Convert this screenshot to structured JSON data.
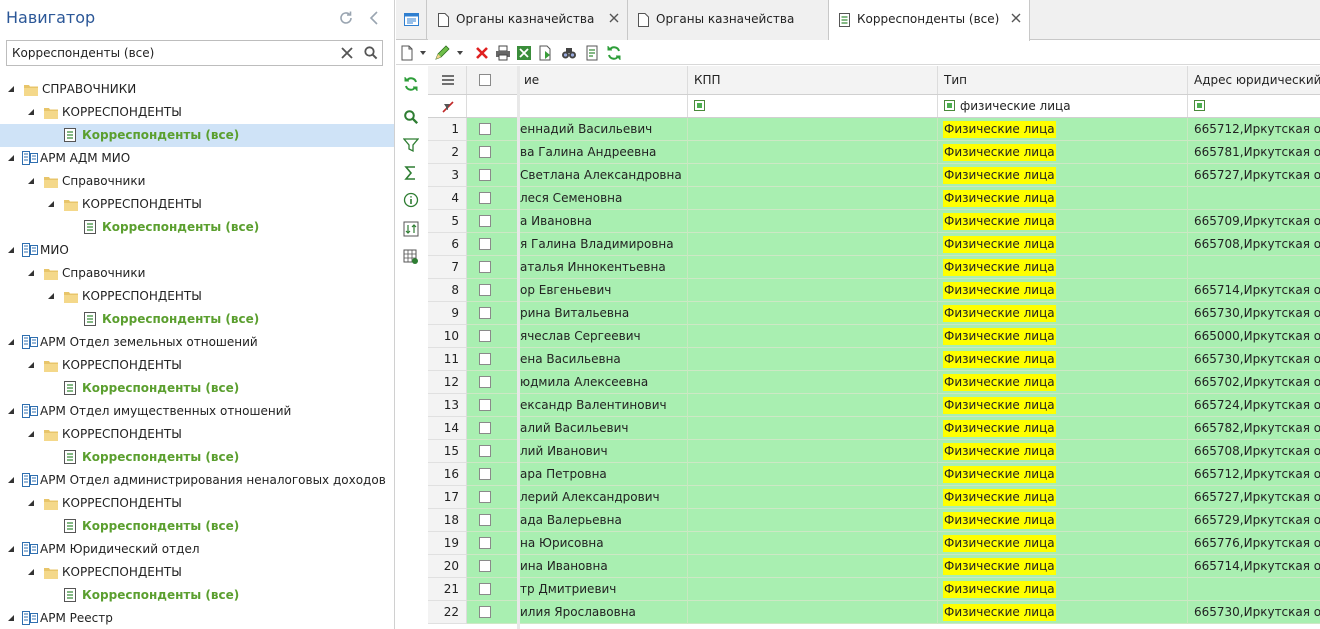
{
  "navigator": {
    "title": "Навигатор",
    "search_value": "Корреспонденты (все)",
    "tree": [
      {
        "level": 0,
        "kind": "folder",
        "label": "СПРАВОЧНИКИ"
      },
      {
        "level": 1,
        "kind": "folder",
        "label": "КОРРЕСПОНДЕНТЫ"
      },
      {
        "level": 2,
        "kind": "doc",
        "label": "Корреспонденты (все)",
        "selected": true
      },
      {
        "level": 0,
        "kind": "arm",
        "label": "АРМ АДМ МИО"
      },
      {
        "level": 1,
        "kind": "folder",
        "label": "Справочники"
      },
      {
        "level": 2,
        "kind": "folder",
        "label": "КОРРЕСПОНДЕНТЫ"
      },
      {
        "level": 3,
        "kind": "doc",
        "label": "Корреспонденты (все)"
      },
      {
        "level": 0,
        "kind": "arm",
        "label": "МИО"
      },
      {
        "level": 1,
        "kind": "folder",
        "label": "Справочники"
      },
      {
        "level": 2,
        "kind": "folder",
        "label": "КОРРЕСПОНДЕНТЫ"
      },
      {
        "level": 3,
        "kind": "doc",
        "label": "Корреспонденты (все)"
      },
      {
        "level": 0,
        "kind": "arm",
        "label": "АРМ Отдел земельных отношений"
      },
      {
        "level": 1,
        "kind": "folder",
        "label": "КОРРЕСПОНДЕНТЫ"
      },
      {
        "level": 2,
        "kind": "doc",
        "label": "Корреспонденты (все)"
      },
      {
        "level": 0,
        "kind": "arm",
        "label": "АРМ Отдел имущественных отношений"
      },
      {
        "level": 1,
        "kind": "folder",
        "label": "КОРРЕСПОНДЕНТЫ"
      },
      {
        "level": 2,
        "kind": "doc",
        "label": "Корреспонденты (все)"
      },
      {
        "level": 0,
        "kind": "arm",
        "label": "АРМ Отдел администрирования неналоговых доходов"
      },
      {
        "level": 1,
        "kind": "folder",
        "label": "КОРРЕСПОНДЕНТЫ"
      },
      {
        "level": 2,
        "kind": "doc",
        "label": "Корреспонденты (все)"
      },
      {
        "level": 0,
        "kind": "arm",
        "label": "АРМ Юридический отдел"
      },
      {
        "level": 1,
        "kind": "folder",
        "label": "КОРРЕСПОНДЕНТЫ"
      },
      {
        "level": 2,
        "kind": "doc",
        "label": "Корреспонденты (все)"
      },
      {
        "level": 0,
        "kind": "arm",
        "label": "АРМ Реестр"
      }
    ]
  },
  "tabs": [
    {
      "label": "Органы казначейства",
      "active": false,
      "closable": true
    },
    {
      "label": "Органы казначейства",
      "active": false,
      "closable": false
    },
    {
      "label": "Корреспонденты (все)",
      "active": true,
      "closable": true
    }
  ],
  "grid": {
    "columns": {
      "name": "ие",
      "kpp": "КПП",
      "type": "Тип",
      "addr": "Адрес юридический"
    },
    "filter": {
      "type": "физические лица"
    },
    "rows": [
      {
        "n": "1",
        "name": "еннадий Васильевич",
        "kpp": "",
        "type": "Физические лица",
        "addr": "665712,Иркутская об"
      },
      {
        "n": "2",
        "name": "ва Галина Андреевна",
        "kpp": "",
        "type": "Физические лица",
        "addr": "665781,Иркутская об"
      },
      {
        "n": "3",
        "name": " Светлана Александровна",
        "kpp": "",
        "type": "Физические лица",
        "addr": "665727,Иркутская об"
      },
      {
        "n": "4",
        "name": "леся Семеновна",
        "kpp": "",
        "type": "Физические лица",
        "addr": ""
      },
      {
        "n": "5",
        "name": "а Ивановна",
        "kpp": "",
        "type": "Физические лица",
        "addr": "665709,Иркутская об"
      },
      {
        "n": "6",
        "name": "я Галина Владимировна",
        "kpp": "",
        "type": "Физические лица",
        "addr": "665708,Иркутская об"
      },
      {
        "n": "7",
        "name": "аталья Иннокентьевна",
        "kpp": "",
        "type": "Физические лица",
        "addr": ""
      },
      {
        "n": "8",
        "name": "ор Евгеньевич",
        "kpp": "",
        "type": "Физические лица",
        "addr": "665714,Иркутская об"
      },
      {
        "n": "9",
        "name": "рина Витальевна",
        "kpp": "",
        "type": "Физические лица",
        "addr": "665730,Иркутская об"
      },
      {
        "n": "10",
        "name": "ячеслав Сергеевич",
        "kpp": "",
        "type": "Физические лица",
        "addr": "665000,Иркутская об"
      },
      {
        "n": "11",
        "name": "ена Васильевна",
        "kpp": "",
        "type": "Физические лица",
        "addr": "665730,Иркутская об"
      },
      {
        "n": "12",
        "name": "юдмила Алексеевна",
        "kpp": "",
        "type": "Физические лица",
        "addr": "665702,Иркутская об"
      },
      {
        "n": "13",
        "name": "ександр Валентинович",
        "kpp": "",
        "type": "Физические лица",
        "addr": "665724,Иркутская об"
      },
      {
        "n": "14",
        "name": "алий Васильевич",
        "kpp": "",
        "type": "Физические лица",
        "addr": "665782,Иркутская об"
      },
      {
        "n": "15",
        "name": "лий Иванович",
        "kpp": "",
        "type": "Физические лица",
        "addr": "665708,Иркутская об"
      },
      {
        "n": "16",
        "name": "ара Петровна",
        "kpp": "",
        "type": "Физические лица",
        "addr": "665712,Иркутская об"
      },
      {
        "n": "17",
        "name": "лерий Александрович",
        "kpp": "",
        "type": "Физические лица",
        "addr": "665727,Иркутская об"
      },
      {
        "n": "18",
        "name": "ада Валерьевна",
        "kpp": "",
        "type": "Физические лица",
        "addr": "665729,Иркутская об"
      },
      {
        "n": "19",
        "name": "на Юрисовна",
        "kpp": "",
        "type": "Физические лица",
        "addr": "665776,Иркутская об"
      },
      {
        "n": "20",
        "name": "ина Ивановна",
        "kpp": "",
        "type": "Физические лица",
        "addr": "665714,Иркутская об"
      },
      {
        "n": "21",
        "name": "тр Дмитриевич",
        "kpp": "",
        "type": "Физические лица",
        "addr": ""
      },
      {
        "n": "22",
        "name": "илия Ярославовна",
        "kpp": "",
        "type": "Физические лица",
        "addr": "665730,Иркутская об"
      }
    ]
  }
}
